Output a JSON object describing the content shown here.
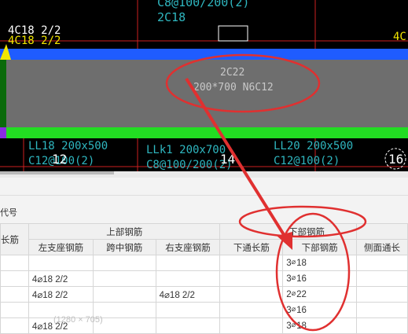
{
  "cad": {
    "top_label_1": "C8@100/200(2)",
    "top_label_2": "2C18",
    "left_rebar_1": "4C18 2/2",
    "left_rebar_2": "4C18 2/2",
    "right_rebar": "4C",
    "beam_rebar": "2C22",
    "beam_spec": "200*700 N6C12",
    "bottom_label_1a": "LL18 200x500",
    "bottom_label_1b": "C12@100(2)",
    "bottom_label_2a": "LLk1 200x700",
    "bottom_label_2b": "C8@100/200(2)",
    "bottom_label_3a": "LL20 200x500",
    "bottom_label_3b": "C12@100(2)",
    "axis_12": "12",
    "axis_14": "14",
    "axis_16": "16",
    "colors": {
      "blue_band": "#1f5cff",
      "green_band": "#22dd22",
      "beam_fill": "#6e6e6e",
      "annotation": "#e03030"
    }
  },
  "panel": {
    "code_label": "代号",
    "ghost_text": "(1280 × 705)",
    "header_top": {
      "col0": "长筋",
      "upper_group": "上部钢筋",
      "lower_group": "下部钢筋"
    },
    "header_sub": {
      "left_support": "左支座钢筋",
      "mid_span": "跨中钢筋",
      "right_support": "右支座钢筋",
      "bottom_through": "下通长筋",
      "bottom_steel": "下部钢筋",
      "side_through": "侧面通长"
    },
    "rows": [
      {
        "left": "",
        "mid": "",
        "right": "",
        "through": "",
        "bottom_n": "3",
        "bottom_s": "18",
        "side": ""
      },
      {
        "left": "4⌀18 2/2",
        "mid": "",
        "right": "",
        "through": "",
        "bottom_n": "3",
        "bottom_s": "16",
        "side": ""
      },
      {
        "left": "4⌀18 2/2",
        "mid": "",
        "right": "4⌀18 2/2",
        "through": "",
        "bottom_n": "2",
        "bottom_s": "22",
        "side": ""
      },
      {
        "left": "",
        "mid": "",
        "right": "",
        "through": "",
        "bottom_n": "3",
        "bottom_s": "16",
        "side": ""
      },
      {
        "left": "4⌀18 2/2",
        "mid": "",
        "right": "",
        "through": "",
        "bottom_n": "3",
        "bottom_s": "18",
        "side": ""
      }
    ]
  }
}
